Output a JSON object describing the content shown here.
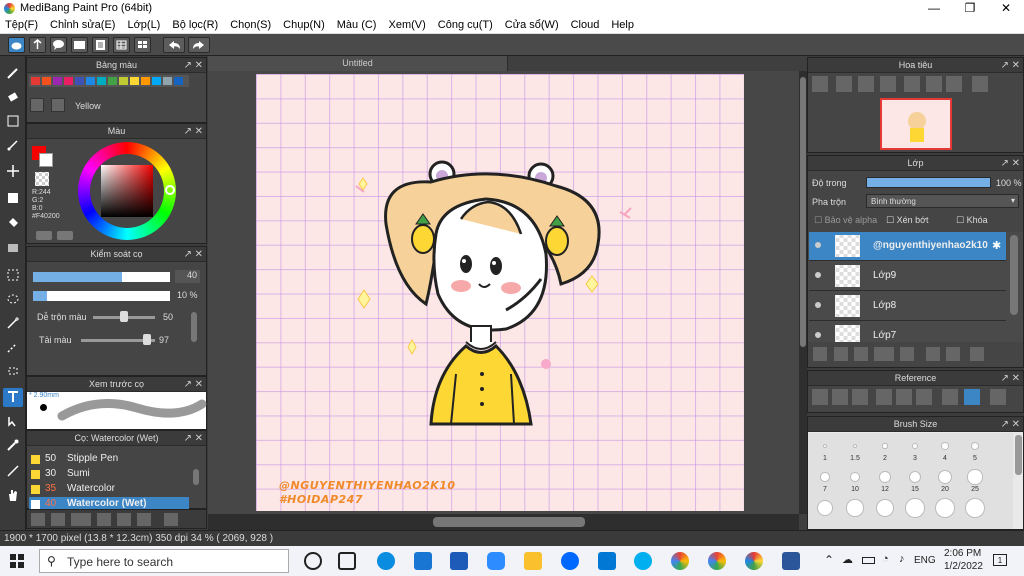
{
  "window": {
    "title": "MediBang Paint Pro (64bit)",
    "minimize": "—",
    "maximize": "❐",
    "close": "✕"
  },
  "menu": [
    "Tệp(F)",
    "Chỉnh sửa(E)",
    "Lớp(L)",
    "Bộ lọc(R)",
    "Chọn(S)",
    "Chụp(N)",
    "Màu (C)",
    "Xem(V)",
    "Công cụ(T)",
    "Cửa sổ(W)",
    "Cloud",
    "Help"
  ],
  "palette_panel": {
    "title": "Bảng màu",
    "current_color_name": "Yellow",
    "swatches": [
      "#e53935",
      "#f4511e",
      "#9c27b0",
      "#e91e63",
      "#3f51b5",
      "#1e88e5",
      "#00acc1",
      "#43a047",
      "#c0ca33",
      "#fdd835",
      "#ff9800",
      "#03a9f4",
      "#90a4ae",
      "#1565c0"
    ]
  },
  "color_panel": {
    "title": "Màu",
    "r": "R:244",
    "g": "G:2",
    "b": "B:0",
    "hex": "#F40200",
    "primary": "#f40200"
  },
  "brush_control": {
    "title": "Kiểm soát cọ",
    "size_value": "40",
    "opacity_value": "10 %",
    "blend_label": "Dễ trộn màu",
    "blend_value": "50",
    "blend_level": 0.5,
    "dilute_label": "Tải màu",
    "dilute_value": "97",
    "dilute_level": 0.97
  },
  "preview": {
    "title": "Xem trước cọ",
    "size_label": "2.90mm"
  },
  "brush_list": {
    "title": "Cọ: Watercolor (Wet)",
    "items": [
      {
        "num": "50",
        "name": "Stipple Pen",
        "color": "#fdd835"
      },
      {
        "num": "30",
        "name": "Sumi",
        "color": "#fdd835"
      },
      {
        "num": "35",
        "name": "Watercolor",
        "color": "#fdd835"
      },
      {
        "num": "40",
        "name": "Watercolor (Wet)",
        "color": "#3d86c6"
      }
    ]
  },
  "document": {
    "tab_title": "Untitled",
    "signature_line1": "@NGUYENTHIYENHAO2K10",
    "signature_line2": "#HOIDAP247"
  },
  "navigator": {
    "title": "Hoa tiêu"
  },
  "layers": {
    "title": "Lớp",
    "opacity_label": "Độ trong",
    "opacity_value": "100 %",
    "blend_label": "Pha trộn",
    "blend_value": "Bình thường",
    "protect_alpha": "Bảo vệ alpha",
    "clipping": "Xén bớt",
    "lock": "Khóa",
    "items": [
      {
        "name": "@nguyenthiyenhao2k10",
        "selected": true
      },
      {
        "name": "Lớp9",
        "selected": false
      },
      {
        "name": "Lớp8",
        "selected": false
      },
      {
        "name": "Lớp7",
        "selected": false
      }
    ]
  },
  "reference": {
    "title": "Reference"
  },
  "brush_size": {
    "title": "Brush Size",
    "sizes": [
      "1",
      "1.5",
      "2",
      "3",
      "4",
      "5",
      "7",
      "10",
      "12",
      "15",
      "20",
      "25",
      "",
      "",
      "",
      "",
      "",
      ""
    ]
  },
  "status": {
    "text": "1900 * 1700 pixel  (13.8 * 12.3cm)  350 dpi  34 %  ( 2069, 928 )"
  },
  "taskbar": {
    "search_placeholder": "Type here to search",
    "lang": "ENG",
    "time": "2:06 PM",
    "date": "1/2/2022",
    "notifications": "1"
  }
}
